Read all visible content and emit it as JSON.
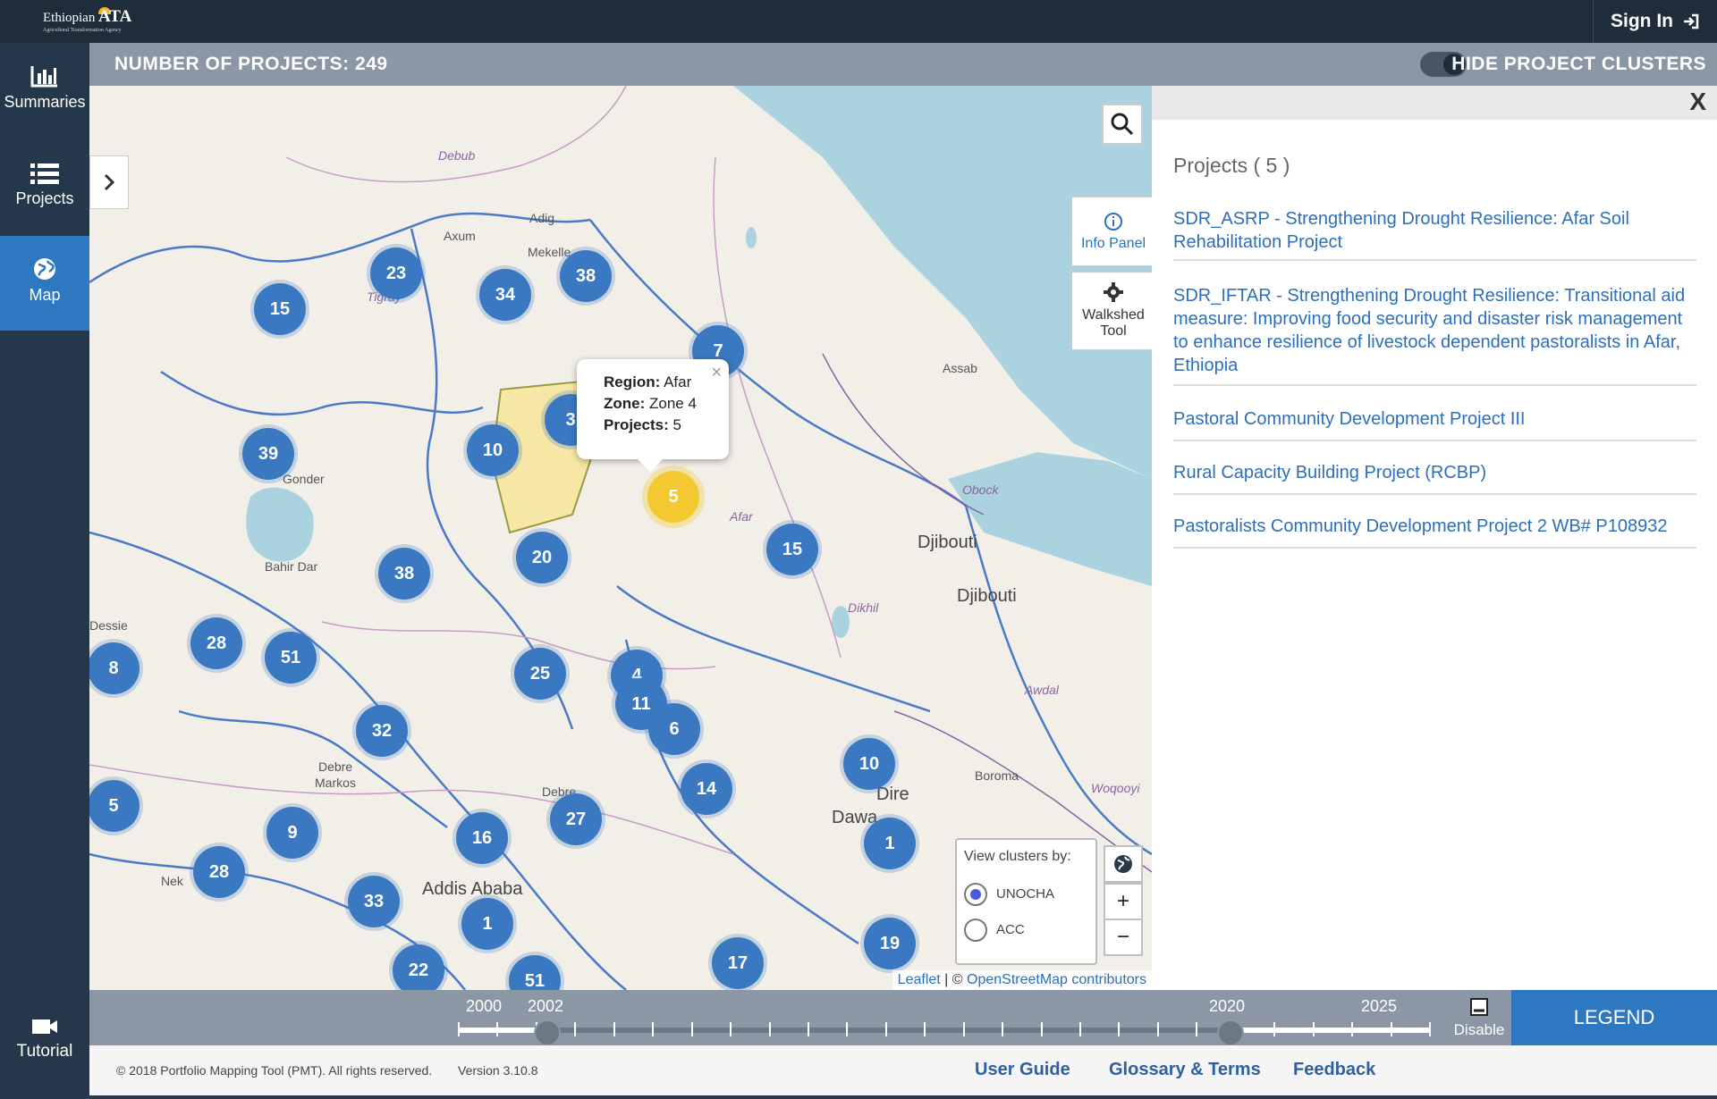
{
  "app": {
    "logo_brand": "Ethiopian",
    "logo_ata": "ATA",
    "logo_sub": "Agricultural Transformation Agency",
    "sign_in": "Sign In"
  },
  "sidebar": {
    "items": [
      {
        "label": "Summaries",
        "icon": "bar-chart-icon"
      },
      {
        "label": "Projects",
        "icon": "list-icon"
      },
      {
        "label": "Map",
        "icon": "globe-icon"
      }
    ],
    "tutorial": "Tutorial"
  },
  "statusbar": {
    "count_label": "NUMBER OF PROJECTS: 249",
    "toggle_label": "HIDE PROJECT CLUSTERS"
  },
  "map": {
    "clusters": [
      "23",
      "15",
      "34",
      "38",
      "7",
      "3",
      "10",
      "39",
      "20",
      "15",
      "38",
      "28",
      "51",
      "8",
      "4",
      "11",
      "6",
      "25",
      "32",
      "14",
      "10",
      "5",
      "9",
      "27",
      "16",
      "1",
      "28",
      "33",
      "1",
      "19",
      "17",
      "22",
      "51"
    ],
    "selected_cluster": "5",
    "labels": [
      "Debub",
      "Adig",
      "Axum",
      "Mekelle",
      "Gonder",
      "Bahir Dar",
      "Dessie",
      "Afar",
      "Djibouti",
      "Djibouti",
      "Assab",
      "Obock",
      "Dikhil",
      "Awdal",
      "Boroma",
      "Woqooyi",
      "Dire",
      "Dawa",
      "Addis Ababa",
      "Debre",
      "Markos",
      "Debre",
      "Nek",
      "Tigray"
    ],
    "popup": {
      "region_key": "Region:",
      "region_val": " Afar",
      "zone_key": "Zone:",
      "zone_val": " Zone 4",
      "projects_key": "Projects:",
      "projects_val": " 5"
    },
    "info_panel_label": "Info Panel",
    "walkshed_label_1": "Walkshed",
    "walkshed_label_2": "Tool",
    "cluster_by": {
      "title": "View clusters by:",
      "options": [
        "UNOCHA",
        "ACC"
      ],
      "selected": "UNOCHA"
    },
    "zoom_in": "+",
    "zoom_out": "−",
    "attribution_leaflet": "Leaflet",
    "attribution_sep": " | © ",
    "attribution_osm": "OpenStreetMap contributors"
  },
  "panel": {
    "close": "X",
    "title": "Projects ( 5 )",
    "projects": [
      "SDR_ASRP - Strengthening Drought Resilience: Afar Soil Rehabilitation Project",
      "SDR_IFTAR - Strengthening Drought Resilience: Transitional aid measure: Improving food security and disaster risk management to enhance resilience of livestock dependent pastoralists in Afar, Ethiopia",
      "Pastoral Community Development Project III",
      "Rural Capacity Building Project (RCBP)",
      "Pastoralists Community Development Project 2 WB# P108932"
    ]
  },
  "timeline": {
    "labels": [
      "2000",
      "2002",
      "2020",
      "2025"
    ],
    "range_start": 2002,
    "range_end": 2020,
    "disable_label": "Disable",
    "legend_label": "LEGEND"
  },
  "footer": {
    "copyright": "© 2018 Portfolio Mapping Tool (PMT). All rights reserved.",
    "version": "Version 3.10.8",
    "links": [
      "User Guide",
      "Glossary & Terms",
      "Feedback"
    ]
  },
  "colors": {
    "nav": "#25384b",
    "accent": "#2e78c2",
    "cluster": "#3a78c2",
    "selected_cluster": "#f4c830",
    "statusbar": "#8b97a4",
    "link": "#2e6fb8"
  }
}
